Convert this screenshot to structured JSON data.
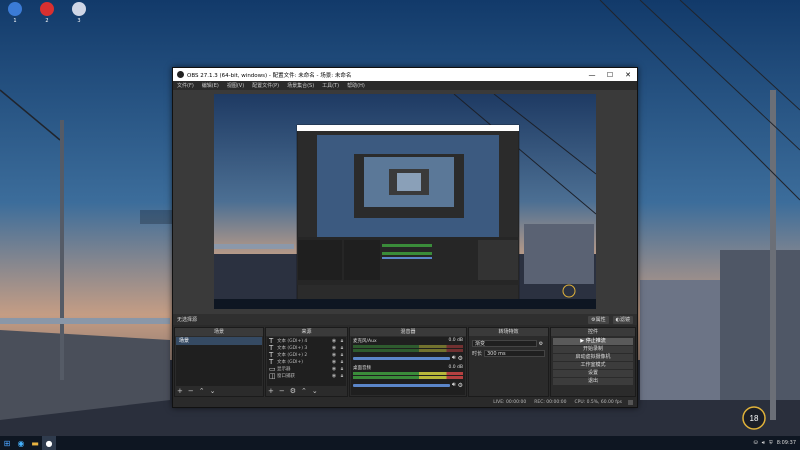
{
  "desktop": {
    "icons": [
      {
        "icon": "search-app-icon",
        "caption": "1",
        "color": "#3b7bd6"
      },
      {
        "icon": "red-circle-app-icon",
        "caption": "2",
        "color": "#d93030"
      },
      {
        "icon": "scissors-app-icon",
        "caption": "3",
        "color": "#cfd6e6"
      }
    ]
  },
  "obs": {
    "title": "OBS 27.1.3 (64-bit, windows) - 配置文件: 未命名 - 场景: 未命名",
    "window_buttons": {
      "minimize": "—",
      "maximize": "☐",
      "close": "✕"
    },
    "menu": [
      "文件(F)",
      "编辑(E)",
      "视图(V)",
      "配置文件(P)",
      "场景集合(S)",
      "工具(T)",
      "帮助(H)"
    ],
    "scene_bar": {
      "current": "无选择源",
      "filters_label": "属性",
      "properties_label": "滤镜"
    },
    "docks": {
      "scenes": {
        "title": "场景",
        "items": [
          "场景"
        ]
      },
      "sources": {
        "title": "来源",
        "items": [
          {
            "name": "文本 (GDI+) 4"
          },
          {
            "name": "文本 (GDI+) 3"
          },
          {
            "name": "文本 (GDI+) 2"
          },
          {
            "name": "文本 (GDI+)"
          },
          {
            "name": "显示器"
          },
          {
            "name": "窗口捕获"
          }
        ]
      },
      "mixer": {
        "title": "混音器",
        "channels": [
          {
            "name": "麦克风/Aux",
            "db": "0.0 dB"
          },
          {
            "name": "桌面音频",
            "db": "0.0 dB"
          }
        ]
      },
      "transitions": {
        "title": "转场特效",
        "type_label": "渐变",
        "duration_label": "时长",
        "duration_value": "300 ms"
      },
      "controls": {
        "title": "控件",
        "buttons": [
          {
            "label": "停止推流",
            "active": true
          },
          {
            "label": "开始录制",
            "active": false
          },
          {
            "label": "启动虚拟摄像机",
            "active": false
          },
          {
            "label": "工作室模式",
            "active": false
          },
          {
            "label": "设置",
            "active": false
          },
          {
            "label": "退出",
            "active": false
          }
        ]
      }
    },
    "status": {
      "live": "LIVE: 00:00:00",
      "rec": "REC: 00:00:00",
      "cpu": "CPU: 0.5%, 60.00 fps"
    }
  },
  "taskbar": {
    "time": "8:09:37",
    "weather": "18"
  },
  "colors": {
    "obs_dark": "#2b2b2b",
    "scene_selected": "#354a63",
    "volume_blue": "#5b86c9"
  }
}
